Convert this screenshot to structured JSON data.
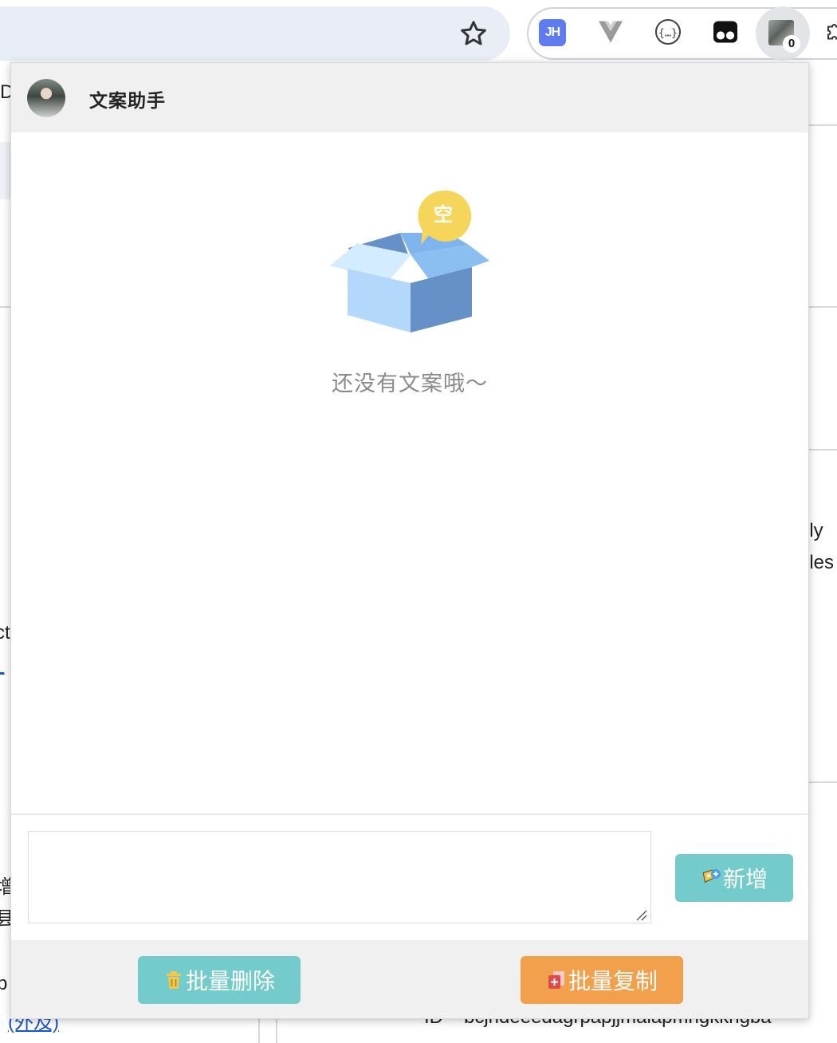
{
  "browser": {
    "extensions": [
      {
        "name": "jh-extension",
        "label": "JH"
      },
      {
        "name": "vue-devtools"
      },
      {
        "name": "json-viewer"
      },
      {
        "name": "tampermonkey"
      },
      {
        "name": "copywriting-assistant",
        "badge": "0"
      }
    ]
  },
  "background_page": {
    "fragments": [
      "D",
      "lly",
      "iles",
      "ct",
      "增",
      "县",
      "b",
      "(外及)",
      "ID",
      "bcjndeeedagrpapjjmalapmngkkngba"
    ]
  },
  "popup": {
    "header": {
      "title": "文案助手"
    },
    "empty_state": {
      "badge": "空",
      "message": "还没有文案哦～"
    },
    "input": {
      "value": "",
      "placeholder": ""
    },
    "add_button": {
      "label": "新增"
    },
    "footer": {
      "delete_button": {
        "label": "批量删除"
      },
      "copy_button": {
        "label": "批量复制"
      }
    }
  },
  "colors": {
    "teal": "#74cbcb",
    "orange": "#f2a04c",
    "badge_yellow": "#f5d55a"
  }
}
